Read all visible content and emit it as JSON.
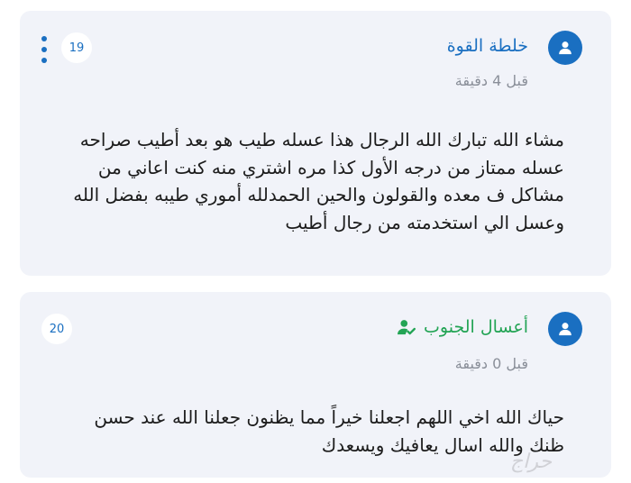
{
  "comments": [
    {
      "username": "خلطة القوة",
      "time": "قبل 4 دقيقة",
      "count": "19",
      "text": "مشاء الله تبارك الله الرجال هذا عسله طيب هو بعد أطيب صراحه عسله ممتاز من درجه الأول كذا مره اشتري منه كنت اعاني من مشاكل ف معده والقولون والحين الحمدلله أموري طيبه بفضل الله وعسل الي استخدمته من رجال أطيب"
    },
    {
      "username": "أعسال الجنوب",
      "time": "قبل 0 دقيقة",
      "count": "20",
      "text": "حياك الله اخي اللهم اجعلنا خيراً مما يظنون جعلنا الله عند حسن ظنك والله اسال يعافيك ويسعدك"
    }
  ],
  "watermark": "حراج",
  "colors": {
    "accent": "#1a6fc1",
    "verified": "#23a455",
    "card": "#f1f3f9"
  },
  "icons": {
    "avatar": "user-icon",
    "verified": "verified-user-icon",
    "menu": "more-vertical-icon"
  }
}
